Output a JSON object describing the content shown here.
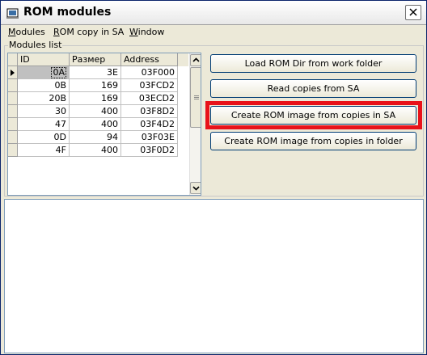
{
  "window": {
    "title": "ROM modules"
  },
  "menu": {
    "modules": {
      "ul": "M",
      "rest": "odules"
    },
    "rom_copy": {
      "ul": "R",
      "rest": "OM copy in SA"
    },
    "window": {
      "ul": "W",
      "rest": "indow"
    }
  },
  "group": {
    "label": "Modules list"
  },
  "grid": {
    "columns": [
      "ID",
      "Размер",
      "Address"
    ],
    "rows": [
      [
        "0A",
        "3E",
        "03F000"
      ],
      [
        "0B",
        "169",
        "03FCD2"
      ],
      [
        "20B",
        "169",
        "03ECD2"
      ],
      [
        "30",
        "400",
        "03F8D2"
      ],
      [
        "47",
        "400",
        "03F4D2"
      ],
      [
        "0D",
        "94",
        "03F03E"
      ],
      [
        "4F",
        "400",
        "03F0D2"
      ]
    ],
    "selected_row": 0
  },
  "buttons": {
    "load_rom_dir": "Load ROM Dir from work folder",
    "read_copies": "Read copies from SA",
    "create_from_sa": "Create ROM image from copies in SA",
    "create_from_folder": "Create ROM image from copies in folder"
  },
  "colors": {
    "highlight": "#e8121a",
    "window_bg": "#ece9d8"
  }
}
